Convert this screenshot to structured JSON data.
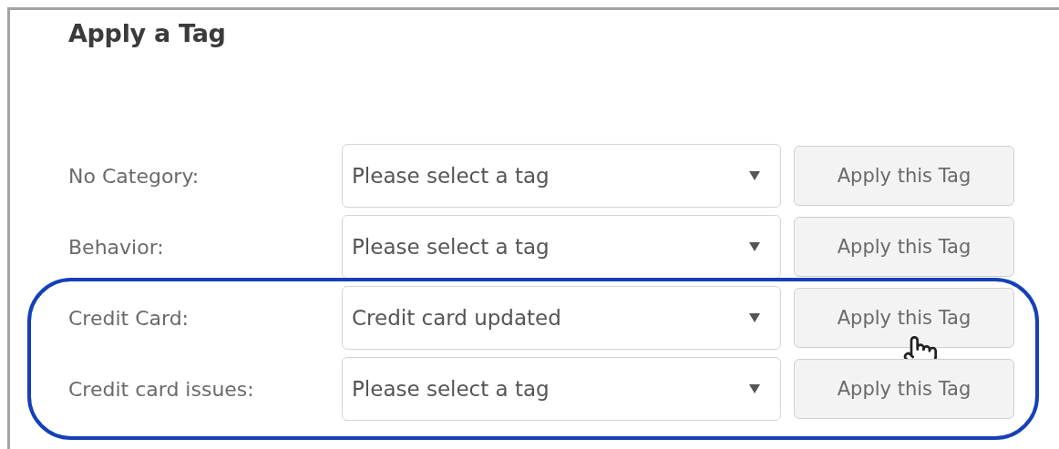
{
  "title": "Apply a Tag",
  "rows": [
    {
      "label": "No Category:",
      "value": "Please select a tag",
      "button": "Apply this Tag",
      "highlighted": false,
      "hovered": false
    },
    {
      "label": "Behavior:",
      "value": "Please select a tag",
      "button": "Apply this Tag",
      "highlighted": false,
      "hovered": false
    },
    {
      "label": "Credit Card:",
      "value": "Credit card updated",
      "button": "Apply this Tag",
      "highlighted": true,
      "hovered": true
    },
    {
      "label": "Credit card issues:",
      "value": "Please select a tag",
      "button": "Apply this Tag",
      "highlighted": true,
      "hovered": false
    }
  ]
}
